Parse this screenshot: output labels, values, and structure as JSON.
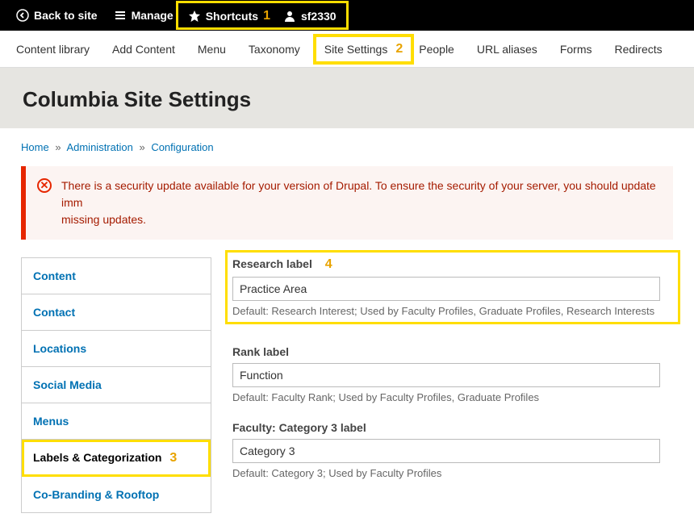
{
  "toolbar": {
    "back": "Back to site",
    "manage": "Manage",
    "shortcuts": "Shortcuts",
    "user": "sf2330",
    "anno1": "1"
  },
  "adminMenu": {
    "items": [
      "Content library",
      "Add Content",
      "Menu",
      "Taxonomy",
      "Site Settings",
      "People",
      "URL aliases",
      "Forms",
      "Redirects"
    ],
    "anno2": "2"
  },
  "pageTitle": "Columbia Site Settings",
  "breadcrumb": {
    "home": "Home",
    "admin": "Administration",
    "config": "Configuration"
  },
  "alert": "There is a security update available for your version of Drupal. To ensure the security of your server, you should update immediately! See the available updates page for more information and to install your missing updates.",
  "alertDisplay": "There is a security update available for your version of Drupal. To ensure the security of your server, you should update imm\nmissing updates.",
  "tabs": [
    "Content",
    "Contact",
    "Locations",
    "Social Media",
    "Menus",
    "Labels & Categorization",
    "Co-Branding & Rooftop"
  ],
  "tabsActiveIndex": 5,
  "anno3": "3",
  "fields": {
    "research": {
      "label": "Research label",
      "value": "Practice Area",
      "desc": "Default: Research Interest; Used by Faculty Profiles, Graduate Profiles, Research Interests",
      "anno": "4"
    },
    "rank": {
      "label": "Rank label",
      "value": "Function",
      "desc": "Default: Faculty Rank; Used by Faculty Profiles, Graduate Profiles"
    },
    "cat3": {
      "label": "Faculty: Category 3 label",
      "value": "Category 3",
      "desc": "Default: Category 3; Used by Faculty Profiles"
    }
  }
}
